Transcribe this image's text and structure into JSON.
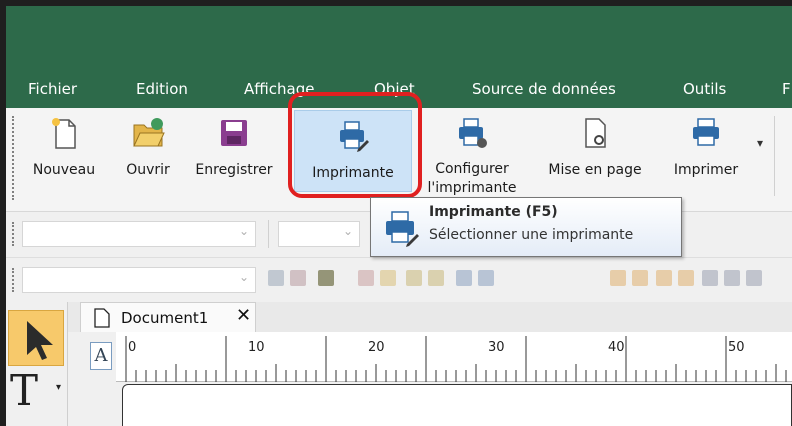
{
  "menu": {
    "items": [
      "Fichier",
      "Edition",
      "Affichage",
      "Objet",
      "Source de données",
      "Outils",
      "F"
    ]
  },
  "ribbon": {
    "buttons": [
      {
        "label": "Nouveau",
        "icon": "new-document-icon"
      },
      {
        "label": "Ouvrir",
        "icon": "open-folder-icon"
      },
      {
        "label": "Enregistrer",
        "icon": "save-disk-icon"
      },
      {
        "label": "Imprimante",
        "icon": "printer-select-icon"
      },
      {
        "label": "Configurer\nl'imprimante",
        "icon": "printer-setup-icon"
      },
      {
        "label": "Mise en page",
        "icon": "page-setup-icon"
      },
      {
        "label": "Imprimer",
        "icon": "print-icon"
      }
    ],
    "dropdown_glyph": "▾"
  },
  "tooltip": {
    "title": "Imprimante (F5)",
    "description": "Sélectionner une imprimante"
  },
  "document": {
    "tab_name": "Document1",
    "close_glyph": "✕"
  },
  "ruler": {
    "labels": [
      "0",
      "10",
      "20",
      "30",
      "40",
      "50"
    ]
  },
  "tools": {
    "text_tool": "T",
    "ruler_corner": "A"
  },
  "colors": {
    "title_bar": "#2d6a4a",
    "highlight": "#e02020",
    "active_button": "#cde3f7"
  }
}
